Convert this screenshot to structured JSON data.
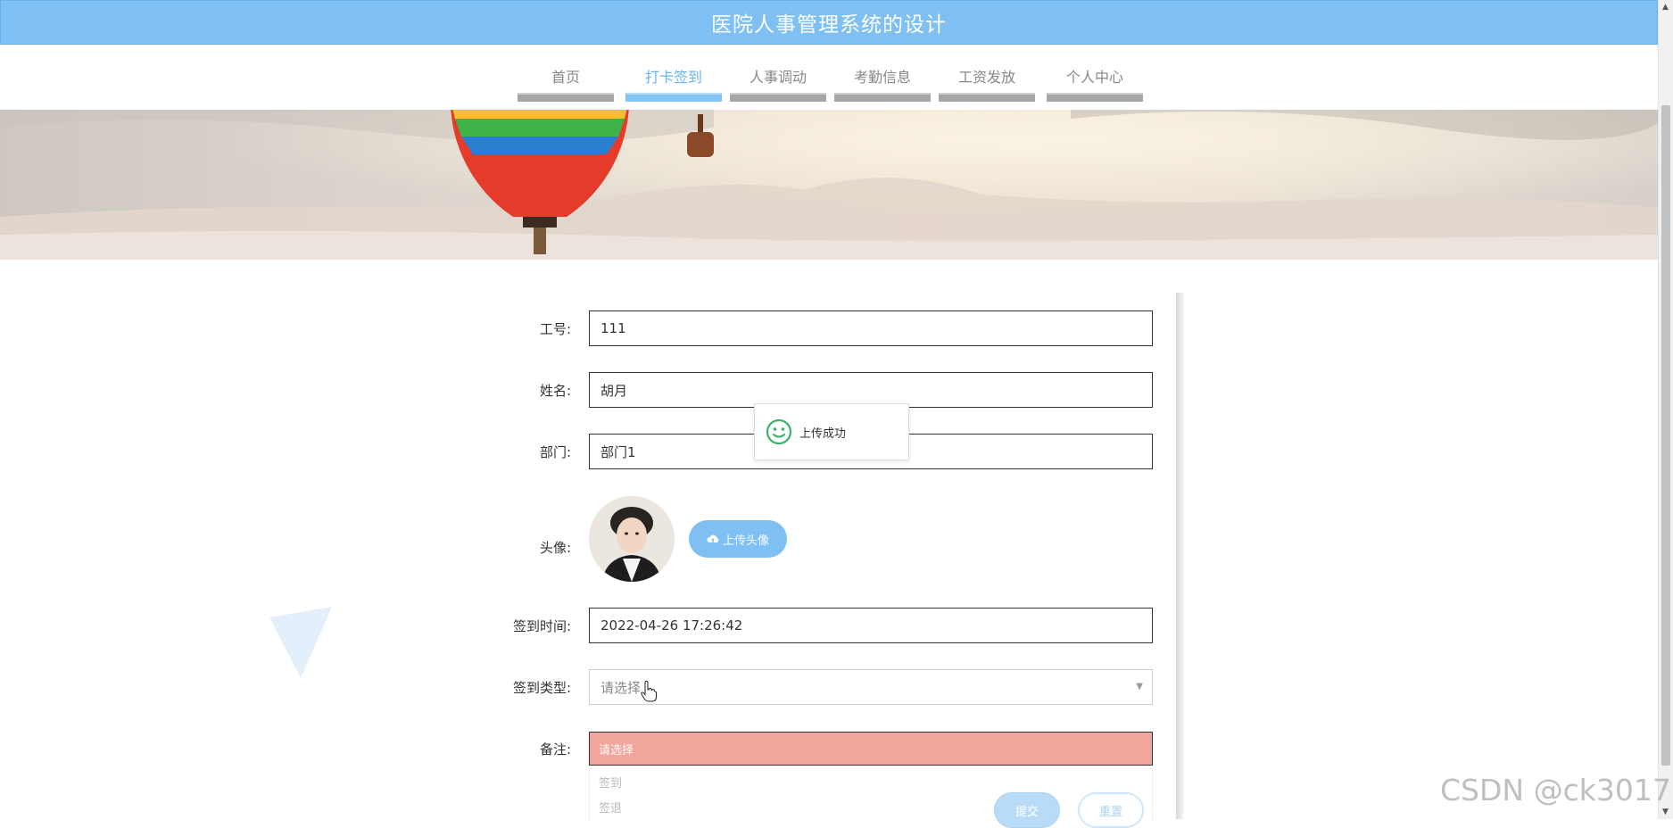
{
  "header": {
    "title": "医院人事管理系统的设计"
  },
  "nav": {
    "items": [
      {
        "label": "首页"
      },
      {
        "label": "打卡签到"
      },
      {
        "label": "人事调动"
      },
      {
        "label": "考勤信息"
      },
      {
        "label": "工资发放"
      },
      {
        "label": "个人中心"
      }
    ],
    "active_index": 1
  },
  "form": {
    "employee_no": {
      "label": "工号:",
      "value": "111"
    },
    "name": {
      "label": "姓名:",
      "value": "胡月"
    },
    "department": {
      "label": "部门:",
      "value": "部门1"
    },
    "avatar": {
      "label": "头像:",
      "upload_button": "上传头像"
    },
    "checkin_time": {
      "label": "签到时间:",
      "value": "2022-04-26 17:26:42"
    },
    "checkin_type": {
      "label": "签到类型:",
      "placeholder": "请选择",
      "options": [
        "请选择",
        "签到",
        "签退"
      ]
    },
    "remark": {
      "label": "备注:"
    },
    "submit_label": "提交",
    "reset_label": "重置"
  },
  "toast": {
    "message": "上传成功"
  },
  "watermark": "CSDN @ck3017",
  "colors": {
    "primary": "#7fc0f4",
    "nav_active": "#6bb3eb",
    "option_highlight": "#f1a59c",
    "toast_icon": "#3cb371"
  },
  "icons": {
    "toast": "smile-icon",
    "upload": "cloud-upload-icon",
    "select": "caret-down-icon",
    "cursor": "hand-pointer-icon"
  }
}
